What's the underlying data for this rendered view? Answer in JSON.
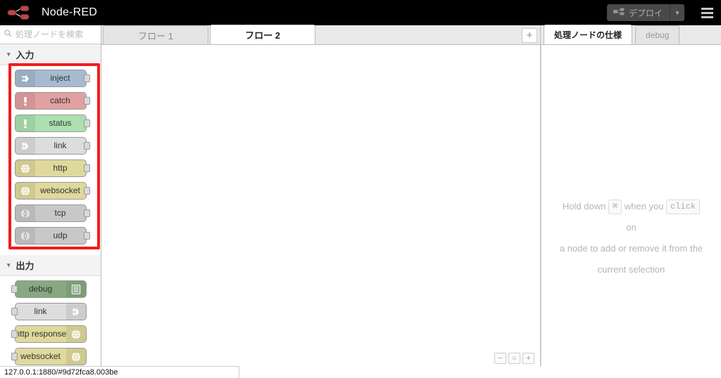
{
  "header": {
    "brand": "Node-RED",
    "logo_icon": "node-red-logo-icon",
    "deploy_label": "デプロイ",
    "deploy_icon": "deploy-node-icon",
    "deploy_dropdown_icon": "chevron-down-icon",
    "menu_icon": "hamburger-menu-icon"
  },
  "palette": {
    "search": {
      "placeholder": "処理ノードを検索",
      "value": "",
      "icon": "search-icon"
    },
    "categories": [
      {
        "id": "input",
        "label": "入力",
        "chevron_icon": "chevron-down-icon",
        "highlighted": true,
        "nodes": [
          {
            "label": "inject",
            "icon": "inject-arrow-icon",
            "bg": "#a6bbcf",
            "port": "right"
          },
          {
            "label": "catch",
            "icon": "exclamation-icon",
            "bg": "#e2a0a0",
            "port": "right"
          },
          {
            "label": "status",
            "icon": "exclamation-icon",
            "bg": "#ace0ae",
            "port": "right"
          },
          {
            "label": "link",
            "icon": "link-arrow-icon",
            "bg": "#dddddd",
            "port": "right"
          },
          {
            "label": "http",
            "icon": "globe-icon",
            "bg": "#dfd99c",
            "port": "right"
          },
          {
            "label": "websocket",
            "icon": "globe-icon",
            "bg": "#dfd99c",
            "port": "right"
          },
          {
            "label": "tcp",
            "icon": "signal-wave-icon",
            "bg": "#c8c8c8",
            "port": "right"
          },
          {
            "label": "udp",
            "icon": "signal-wave-icon",
            "bg": "#c8c8c8",
            "port": "right"
          }
        ]
      },
      {
        "id": "output",
        "label": "出力",
        "chevron_icon": "chevron-down-icon",
        "highlighted": false,
        "nodes": [
          {
            "label": "debug",
            "icon": "debug-list-icon",
            "bg": "#87a980",
            "port": "left"
          },
          {
            "label": "link",
            "icon": "link-arrow-icon",
            "bg": "#dddddd",
            "port": "left"
          },
          {
            "label": "http response",
            "icon": "globe-icon",
            "bg": "#dfd99c",
            "port": "left"
          },
          {
            "label": "websocket",
            "icon": "globe-icon",
            "bg": "#dfd99c",
            "port": "left"
          }
        ]
      }
    ]
  },
  "workspace": {
    "tabs": [
      {
        "label": "フロー 1",
        "active": false
      },
      {
        "label": "フロー 2",
        "active": true
      }
    ],
    "add_tab_label": "+",
    "add_tab_icon": "plus-icon",
    "zoom_controls": [
      {
        "id": "zoom-out",
        "label": "−",
        "icon": "minus-icon"
      },
      {
        "id": "zoom-reset",
        "label": "○",
        "icon": "circle-icon"
      },
      {
        "id": "zoom-in",
        "label": "+",
        "icon": "plus-icon"
      }
    ]
  },
  "sidebar": {
    "tabs": [
      {
        "label": "処理ノードの仕様",
        "active": true
      },
      {
        "label": "debug",
        "active": false
      }
    ],
    "tip": {
      "part1": "Hold down",
      "key1": "⌘",
      "part2": "when you",
      "key2": "click",
      "part3": "on",
      "line2": "a node to add or remove it from the",
      "line3": "current selection"
    }
  },
  "statusbar": {
    "url": "127.0.0.1:1880/#9d72fca8.003be"
  },
  "colors": {
    "header_bg": "#000000",
    "highlight_red": "#f41b1b",
    "deploy_bg": "#4d4d4d"
  }
}
